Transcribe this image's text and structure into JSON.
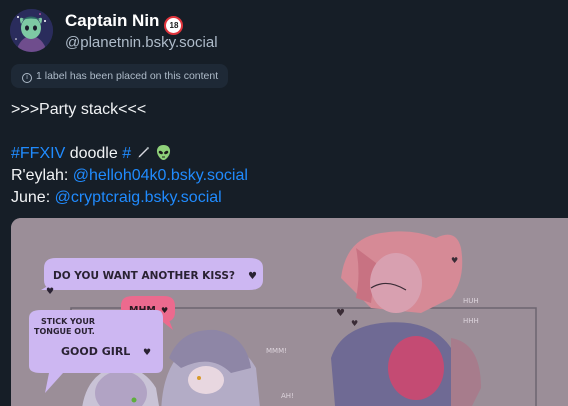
{
  "post": {
    "author": {
      "display_name": "Captain Nin",
      "nsfw_badge": "18",
      "handle": "@planetnin.bsky.social",
      "avatar_icon": "avatar-alien-character"
    },
    "label_notice": "1 label has been placed on this content",
    "text": {
      "line1": ">>>Party stack<<<",
      "tag_ffxiv": "#FFXIV",
      "word_doodle": "doodle",
      "tag_hash": "#",
      "emoji_1": "pen-icon",
      "emoji_2": "alien-icon",
      "reylah_label": "R'eylah:",
      "reylah_handle": "@helloh04k0.bsky.social",
      "june_label": "June:",
      "june_handle": "@cryptcraig.bsky.social"
    },
    "image": {
      "bubble_1": "DO YOU WANT ANOTHER KISS?",
      "bubble_2": "MHM",
      "bubble_3_line1": "STICK YOUR",
      "bubble_3_line2": "TONGUE OUT.",
      "bubble_4": "GOOD GIRL",
      "sfx_1": "HUH",
      "sfx_2": "HHH",
      "sfx_3": "MMM!",
      "sfx_4": "AH!"
    },
    "colors": {
      "background": "#161e27",
      "link": "#208bfe",
      "muted": "#aebbc9",
      "bubble_lavender": "#cdb7f2",
      "bubble_pink": "#ec6a8e"
    }
  }
}
